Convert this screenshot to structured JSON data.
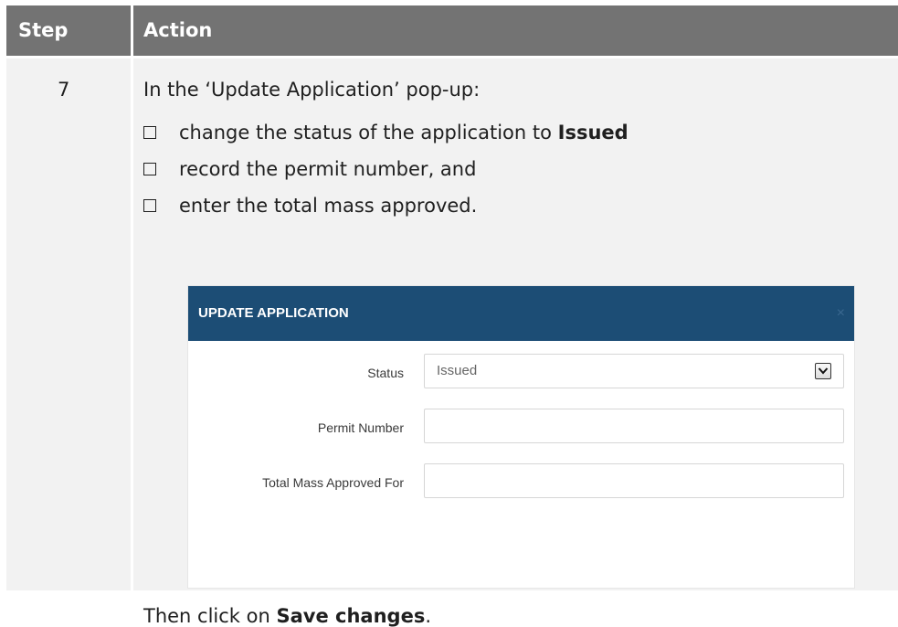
{
  "table": {
    "headers": {
      "step": "Step",
      "action": "Action"
    },
    "row": {
      "step": "7",
      "intro": "In the ‘Update Application’ pop-up:",
      "bullets": [
        {
          "text": "change the status of the application to ",
          "bold": "Issued"
        },
        {
          "text": "record the permit number, and",
          "bold": ""
        },
        {
          "text": "enter the total mass approved.",
          "bold": ""
        }
      ],
      "outro_prefix": "Then click on ",
      "outro_bold": "Save changes",
      "outro_suffix": "."
    }
  },
  "popup": {
    "title": "UPDATE APPLICATION",
    "close_glyph": "×",
    "fields": {
      "status_label": "Status",
      "status_value": "Issued",
      "permit_label": "Permit Number",
      "permit_value": "",
      "mass_label": "Total Mass Approved For",
      "mass_value": ""
    }
  },
  "colors": {
    "header_bg": "#737373",
    "cell_bg": "#f2f2f2",
    "popup_header_bg": "#1c4d75"
  },
  "icons": {
    "bullet": "checkbox-outline-icon",
    "dropdown": "chevron-down-icon"
  }
}
